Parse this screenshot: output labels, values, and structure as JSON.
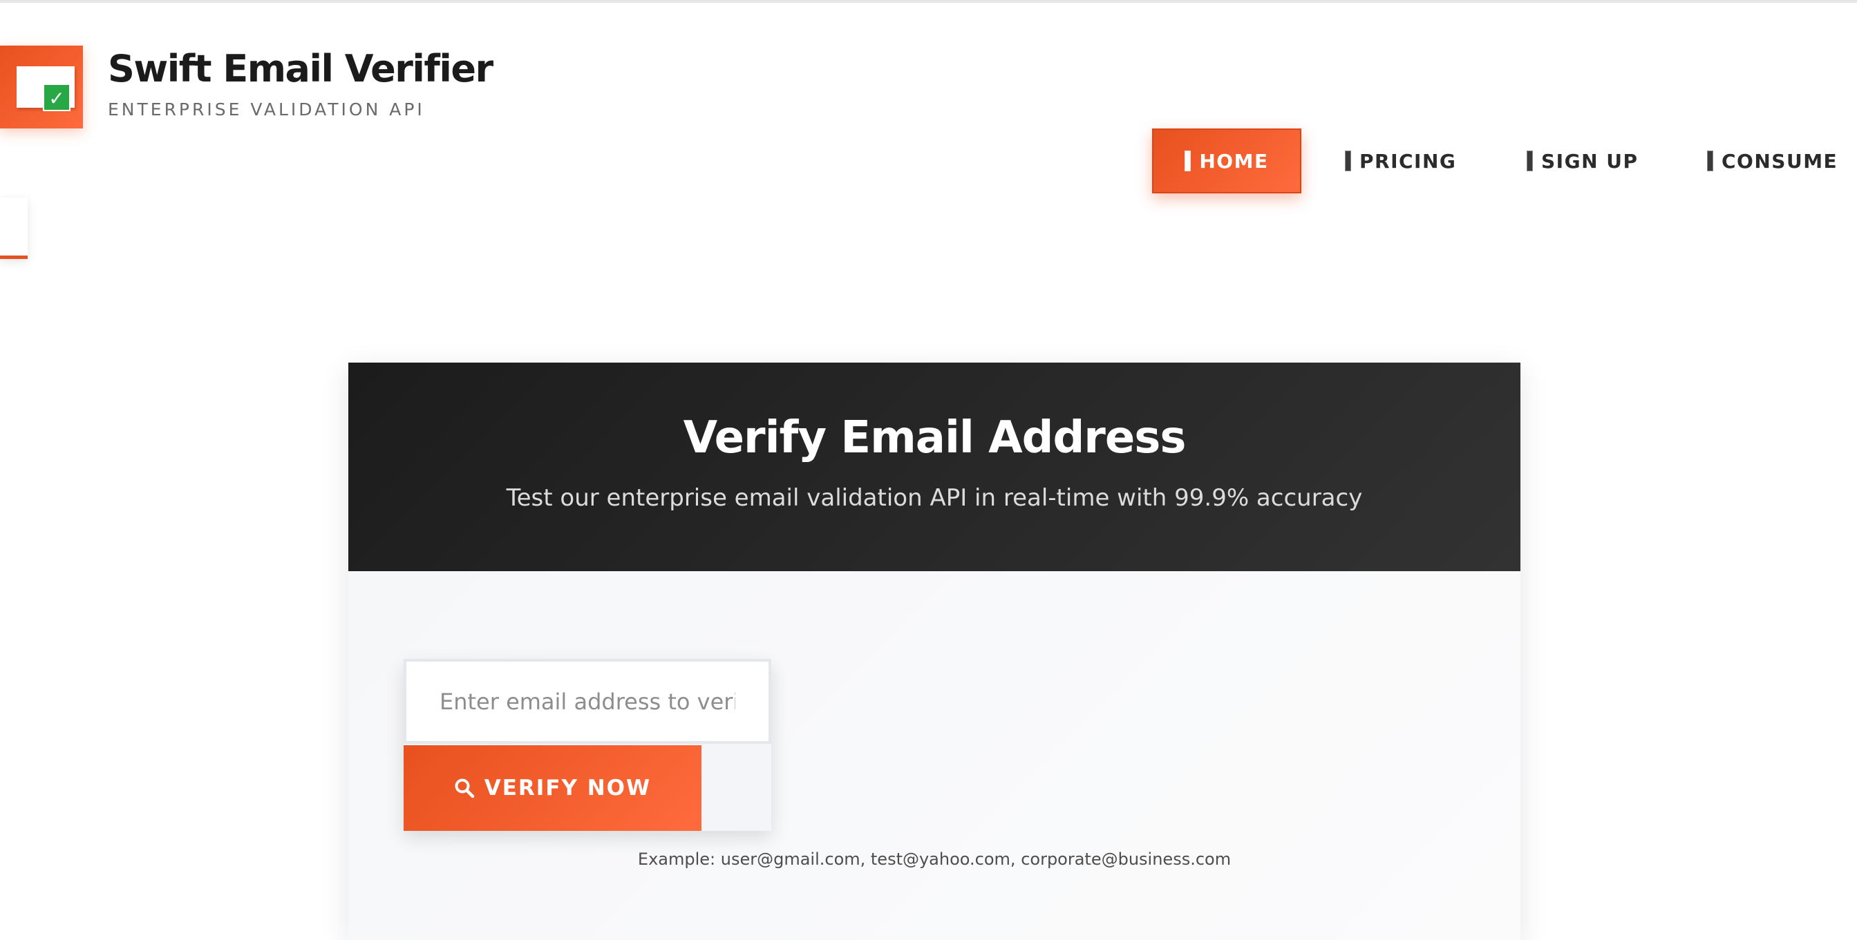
{
  "brand": {
    "title": "Swift Email Verifier",
    "subtitle": "ENTERPRISE VALIDATION API",
    "logo_icon": "envelope-check-icon",
    "accent_color": "#e8511f",
    "check_color": "#27a845"
  },
  "nav": {
    "items": [
      {
        "label": "HOME",
        "active": true
      },
      {
        "label": "PRICING",
        "active": false
      },
      {
        "label": "SIGN UP",
        "active": false
      },
      {
        "label": "CONSUME",
        "active": false
      }
    ]
  },
  "hero": {
    "title": "Verify Email Address",
    "subtitle": "Test our enterprise email validation API in real-time with 99.9% accuracy"
  },
  "form": {
    "email_placeholder": "Enter email address to verify",
    "email_value": "",
    "verify_label": "VERIFY NOW",
    "verify_icon": "search-icon",
    "example": "Example: user@gmail.com, test@yahoo.com, corporate@business.com"
  }
}
